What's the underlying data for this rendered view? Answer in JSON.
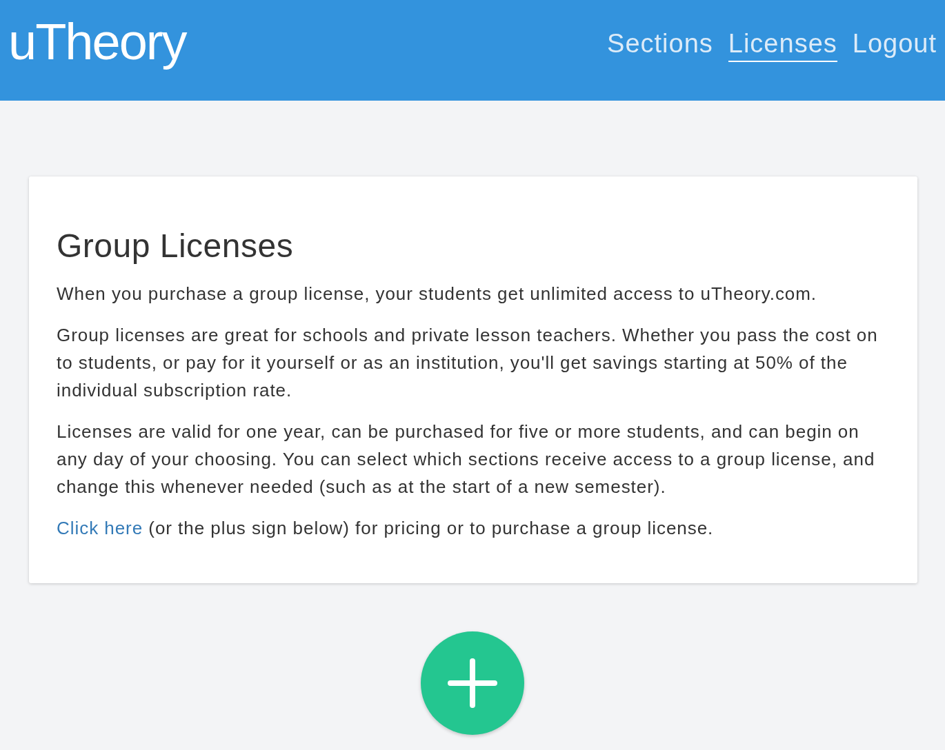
{
  "header": {
    "logo": "uTheory",
    "nav": [
      {
        "label": "Sections",
        "selected": false
      },
      {
        "label": "Licenses",
        "selected": true
      },
      {
        "label": "Logout",
        "selected": false
      }
    ]
  },
  "card": {
    "title": "Group Licenses",
    "paragraphs": [
      "When you purchase a group license, your students get unlimited access to uTheory.com.",
      "Group licenses are great for schools and private lesson teachers. Whether you pass the cost on to students, or pay for it yourself or as an institution, you'll get savings starting at 50% of the individual subscription rate.",
      "Licenses are valid for one year, can be purchased for five or more students, and can begin on any day of your choosing. You can select which sections receive access to a group license, and change this whenever needed (such as at the start of a new semester)."
    ],
    "call_to_action": {
      "link": "Click here",
      "text": "(or the plus sign below) for pricing or to purchase a group license."
    }
  }
}
